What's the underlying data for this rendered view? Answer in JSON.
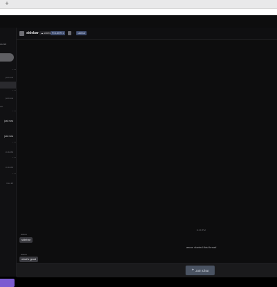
{
  "browser": {
    "new_tab_icon": "plus-icon",
    "new_tab_glyph": "+"
  },
  "sidebar": {
    "header_text": "ound",
    "items": [
      {
        "text": "just now",
        "variant": "dim"
      },
      {
        "text": "",
        "variant": "active"
      },
      {
        "text": "just now",
        "variant": "dim"
      },
      {
        "text": "eet",
        "variant": "left"
      },
      {
        "text": "just now",
        "variant": "bright"
      },
      {
        "text": "just now",
        "variant": "bright"
      },
      {
        "text": "3:16 PM",
        "variant": "dim"
      },
      {
        "text": "3:16 PM",
        "variant": "dim"
      },
      {
        "text": "Nov 25",
        "variant": "dim"
      }
    ]
  },
  "header": {
    "channel_name": "sidebar",
    "chip_1": "☁ sidebar",
    "chip_2": "FOLDER 1",
    "separator": "›",
    "chip_3": "sidebar"
  },
  "messages": {
    "day_divider": "3:25 PM",
    "system_message": "aaron started this thread",
    "items": [
      {
        "author": "aaron",
        "text": "sidebar"
      },
      {
        "author": "aaron",
        "text": "what's good"
      }
    ]
  },
  "footer": {
    "join_label": "Join Chat",
    "join_icon": "plus-icon",
    "join_glyph": "+"
  }
}
